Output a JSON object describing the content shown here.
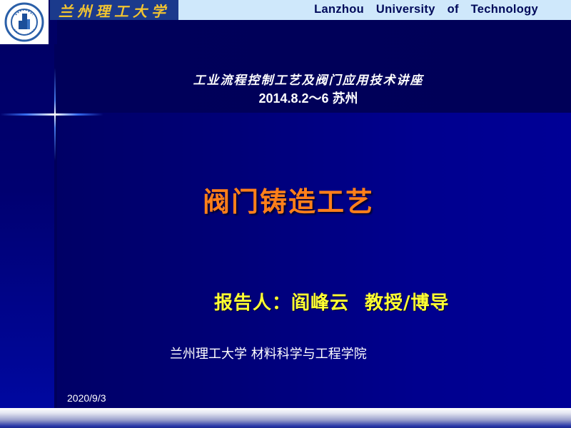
{
  "header": {
    "logo_icon": "university-seal-icon",
    "calligraphy_name": "兰州理工大学",
    "english_name": "Lanzhou University of Technology"
  },
  "slide": {
    "subtitle_line1": "工业流程控制工艺及阀门应用技术讲座",
    "subtitle_line2": "2014.8.2～6 苏州",
    "title": "阀门铸造工艺",
    "presenter_label": "报告人：",
    "presenter_name": "阎峰云",
    "presenter_title": "教授/博导",
    "affiliation": "兰州理工大学 材料科学与工程学院",
    "date": "2020/9/3"
  },
  "colors": {
    "background": "#000066",
    "header_band": "#cfe8fb",
    "title": "#ff7f1a",
    "presenter": "#ffff33",
    "calligraphy": "#f3c530"
  }
}
